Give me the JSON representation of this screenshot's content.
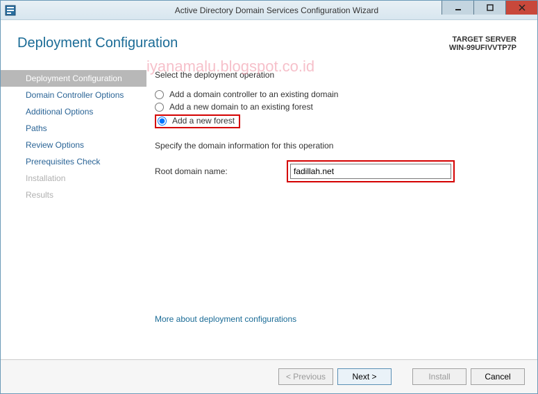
{
  "titlebar": {
    "title": "Active Directory Domain Services Configuration Wizard"
  },
  "header": {
    "page_title": "Deployment Configuration",
    "target_label": "TARGET SERVER",
    "target_name": "WIN-99UFIVVTP7P"
  },
  "watermark": "iyanamalu.blogspot.co.id",
  "sidebar": {
    "items": [
      {
        "label": "Deployment Configuration",
        "state": "active"
      },
      {
        "label": "Domain Controller Options",
        "state": "normal"
      },
      {
        "label": "Additional Options",
        "state": "normal"
      },
      {
        "label": "Paths",
        "state": "normal"
      },
      {
        "label": "Review Options",
        "state": "normal"
      },
      {
        "label": "Prerequisites Check",
        "state": "normal"
      },
      {
        "label": "Installation",
        "state": "disabled"
      },
      {
        "label": "Results",
        "state": "disabled"
      }
    ]
  },
  "main": {
    "section1_label": "Select the deployment operation",
    "radio1": "Add a domain controller to an existing domain",
    "radio2": "Add a new domain to an existing forest",
    "radio3": "Add a new forest",
    "section2_label": "Specify the domain information for this operation",
    "root_domain_label": "Root domain name:",
    "root_domain_value": "fadillah.net",
    "more_link": "More about deployment configurations"
  },
  "footer": {
    "previous": "< Previous",
    "next": "Next >",
    "install": "Install",
    "cancel": "Cancel"
  }
}
